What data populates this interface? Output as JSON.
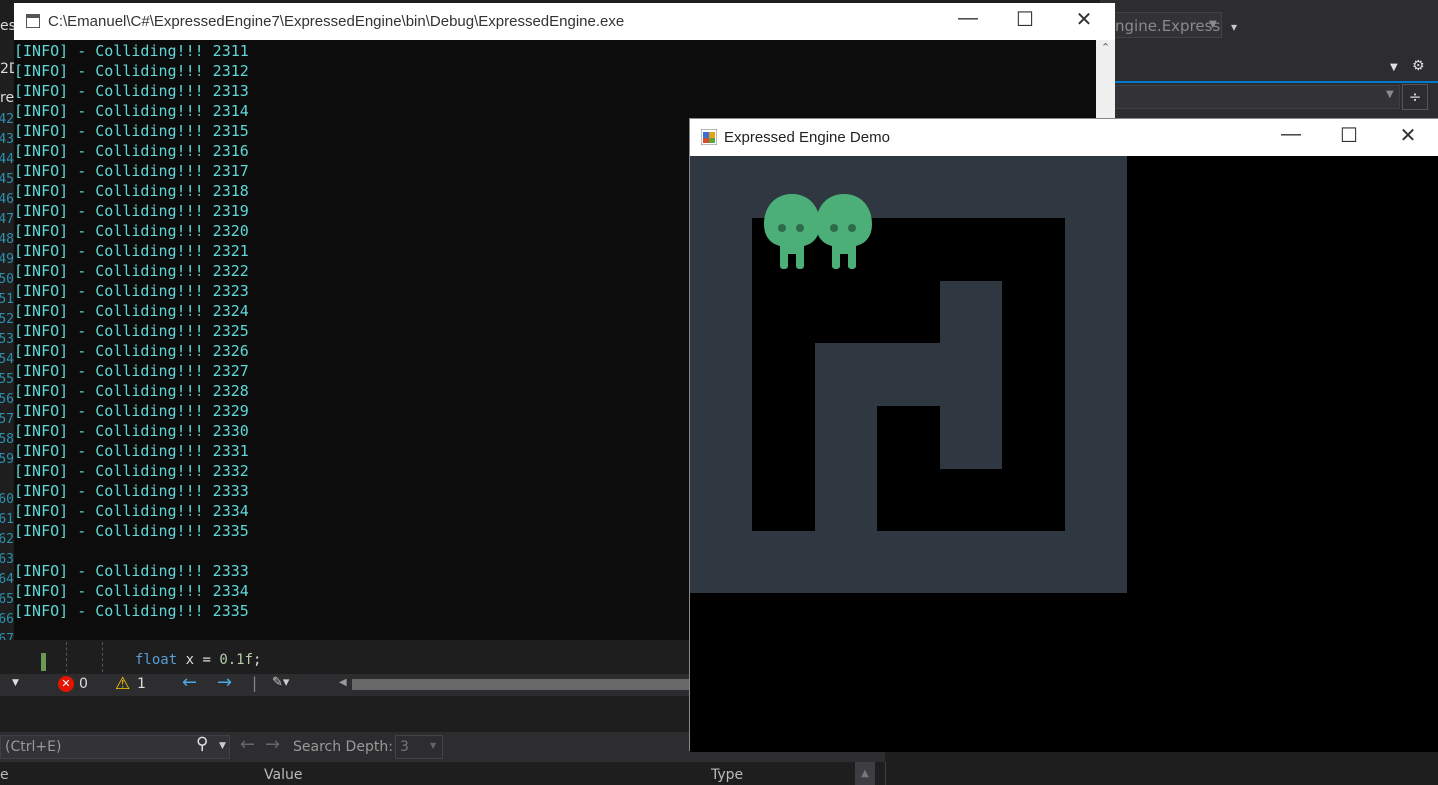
{
  "ide": {
    "config_combo": "ngine.Express",
    "left_fragments": [
      "es",
      "2D",
      "re"
    ],
    "line_numbers": [
      "42",
      "43",
      "44",
      "45",
      "46",
      "47",
      "48",
      "49",
      "50",
      "51",
      "52",
      "53",
      "54",
      "55",
      "56",
      "57",
      "58",
      "59",
      "",
      "60",
      "61",
      "62",
      "63",
      "64",
      "65",
      "66",
      "67"
    ],
    "code": {
      "keyword": "float",
      "rest": " x = ",
      "number": "0.1f",
      "end": ";"
    },
    "status": {
      "errors": "0",
      "warnings": "1"
    },
    "find": {
      "placeholder": "(Ctrl+E)",
      "search_depth_label": "Search Depth:",
      "search_depth_value": "3"
    },
    "columns": {
      "name_fragment": "e",
      "value": "Value",
      "type": "Type"
    }
  },
  "console": {
    "title": "C:\\Emanuel\\C#\\ExpressedEngine7\\ExpressedEngine\\bin\\Debug\\ExpressedEngine.exe",
    "lines": [
      "[INFO] - Colliding!!! 2311",
      "[INFO] - Colliding!!! 2312",
      "[INFO] - Colliding!!! 2313",
      "[INFO] - Colliding!!! 2314",
      "[INFO] - Colliding!!! 2315",
      "[INFO] - Colliding!!! 2316",
      "[INFO] - Colliding!!! 2317",
      "[INFO] - Colliding!!! 2318",
      "[INFO] - Colliding!!! 2319",
      "[INFO] - Colliding!!! 2320",
      "[INFO] - Colliding!!! 2321",
      "[INFO] - Colliding!!! 2322",
      "[INFO] - Colliding!!! 2323",
      "[INFO] - Colliding!!! 2324",
      "[INFO] - Colliding!!! 2325",
      "[INFO] - Colliding!!! 2326",
      "[INFO] - Colliding!!! 2327",
      "[INFO] - Colliding!!! 2328",
      "[INFO] - Colliding!!! 2329",
      "[INFO] - Colliding!!! 2330",
      "[INFO] - Colliding!!! 2331",
      "[INFO] - Colliding!!! 2332",
      "[INFO] - Colliding!!! 2333",
      "[INFO] - Colliding!!! 2334",
      "[INFO] - Colliding!!! 2335",
      "",
      "[INFO] - Colliding!!! 2333",
      "[INFO] - Colliding!!! 2334",
      "[INFO] - Colliding!!! 2335"
    ],
    "text_color": "#61d6d6"
  },
  "game": {
    "title": "Expressed Engine Demo",
    "colors": {
      "wall": "#2f3741",
      "floor": "#000000",
      "player": "#4caf78"
    }
  }
}
